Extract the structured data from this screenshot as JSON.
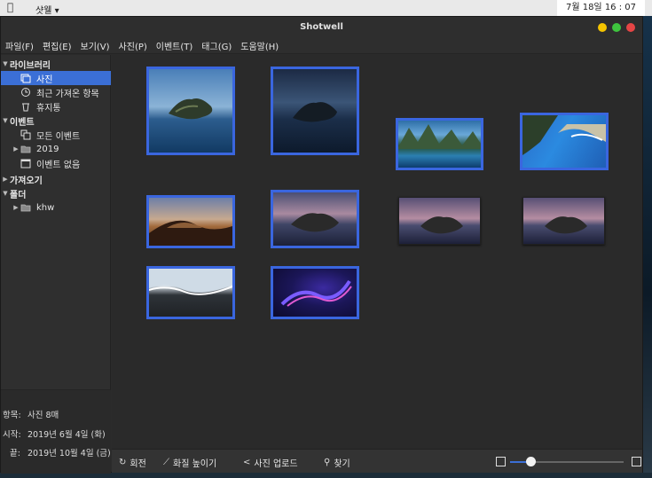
{
  "top_panel": {
    "app_menu": "샷웰 ▾",
    "clock": "7월 18일  16 : 07"
  },
  "window": {
    "title": "Shotwell",
    "menu": [
      "파일(F)",
      "편집(E)",
      "보기(V)",
      "사진(P)",
      "이벤트(T)",
      "태그(G)",
      "도움말(H)"
    ],
    "controls": {
      "minimize_color": "#f5c400",
      "maximize_color": "#3ec43e",
      "close_color": "#e64545"
    }
  },
  "sidebar": {
    "library_header": "라이브러리",
    "photos": "사진",
    "recent_import": "최근 가져온 항목",
    "trash": "휴지통",
    "events_header": "이벤트",
    "all_events": "모든 이벤트",
    "year": "2019",
    "no_event": "이벤트 없음",
    "import_header": "가져오기",
    "folders_header": "폴더",
    "folder": "khw",
    "accent": "#3b6fd6"
  },
  "info": {
    "items_label": "항목:",
    "items_value": "사진 8매",
    "start_label": "시작:",
    "start_value": "2019년 6월 4일 (화)",
    "end_label": "끝:",
    "end_value": "2019년 10월 4일 (금)"
  },
  "toolbar": {
    "rotate": "회전",
    "enhance": "화질 높이기",
    "upload": "사진 업로드",
    "find": "찾기",
    "zoom_level": 0.18
  },
  "thumbnails": [
    {
      "name": "catalina-island-day",
      "selected": true
    },
    {
      "name": "catalina-island-night",
      "selected": true
    },
    {
      "name": "mountain-lake",
      "selected": true
    },
    {
      "name": "coastal-cove",
      "selected": true
    },
    {
      "name": "desert-dunes",
      "selected": true
    },
    {
      "name": "catalina-dusk",
      "selected": true
    },
    {
      "name": "catalina-pink-1",
      "selected": false
    },
    {
      "name": "catalina-pink-2",
      "selected": false
    },
    {
      "name": "ocean-wave",
      "selected": true
    },
    {
      "name": "abstract-purple-swirl",
      "selected": true
    }
  ]
}
